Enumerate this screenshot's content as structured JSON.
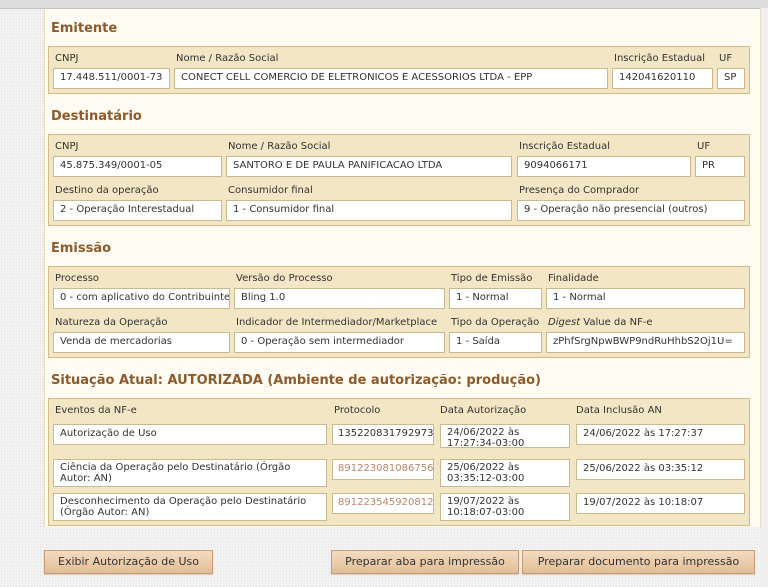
{
  "emitente": {
    "title": "Emitente",
    "labels": {
      "cnpj": "CNPJ",
      "razao": "Nome / Razão Social",
      "ie": "Inscrição Estadual",
      "uf": "UF"
    },
    "values": {
      "cnpj": "17.448.511/0001-73",
      "razao": "CONECT CELL COMERCIO DE ELETRONICOS E ACESSORIOS LTDA - EPP",
      "ie": "142041620110",
      "uf": "SP"
    }
  },
  "destinatario": {
    "title": "Destinatário",
    "labels": {
      "cnpj": "CNPJ",
      "razao": "Nome / Razão Social",
      "ie": "Inscrição Estadual",
      "uf": "UF",
      "destino": "Destino da operação",
      "consumidor": "Consumidor final",
      "presenca": "Presença do Comprador"
    },
    "values": {
      "cnpj": "45.875.349/0001-05",
      "razao": "SANTORO E DE PAULA PANIFICACAO LTDA",
      "ie": "9094066171",
      "uf": "PR",
      "destino": "2 - Operação Interestadual",
      "consumidor": "1 - Consumidor final",
      "presenca": "9 - Operação não presencial (outros)"
    }
  },
  "emissao": {
    "title": "Emissão",
    "labels": {
      "processo": "Processo",
      "versao": "Versão do Processo",
      "tipo_emissao": "Tipo de Emissão",
      "finalidade": "Finalidade",
      "natureza": "Natureza da Operação",
      "intermediador": "Indicador de Intermediador/Marketplace",
      "tipo_operacao": "Tipo da Operação",
      "digest_em": "Digest",
      "digest_rest": " Value da NF-e"
    },
    "values": {
      "processo": "0 - com aplicativo do Contribuinte",
      "versao": "Bling 1.0",
      "tipo_emissao": "1 - Normal",
      "finalidade": "1 - Normal",
      "natureza": "Venda de mercadorias",
      "intermediador": "0 - Operação sem intermediador",
      "tipo_operacao": "1 - Saída",
      "digest": "zPhfSrgNpwBWP9ndRuHhbS2Oj1U="
    }
  },
  "situacao": {
    "title": "Situação Atual: AUTORIZADA (Ambiente de autorização: produção)",
    "headers": {
      "eventos": "Eventos da NF-e",
      "protocolo": "Protocolo",
      "data_aut": "Data Autorização",
      "data_inc": "Data Inclusão AN"
    },
    "rows": [
      {
        "evento": "Autorização de Uso",
        "protocolo": "135220831792973",
        "data_aut": "24/06/2022 às 17:27:34-03:00",
        "data_inc": "24/06/2022 às 17:27:37"
      },
      {
        "evento": "Ciência da Operação pelo Destinatário (Órgão Autor: AN)",
        "protocolo": "891223081086756",
        "data_aut": "25/06/2022 às 03:35:12-03:00",
        "data_inc": "25/06/2022 às 03:35:12"
      },
      {
        "evento": "Desconhecimento da Operação pelo Destinatário (Órgão Autor: AN)",
        "protocolo": "891223545920812",
        "data_aut": "19/07/2022 às 10:18:07-03:00",
        "data_inc": "19/07/2022 às 10:18:07"
      }
    ]
  },
  "buttons": {
    "autorizacao": "Exibir Autorização de Uso",
    "aba": "Preparar aba para impressão",
    "documento": "Preparar documento para impressão"
  },
  "colors": {
    "section_title": "#8c5a2c",
    "box_bg": "#f2e6c5",
    "box_border": "#d1bc8c",
    "button_bg": "#e8c9a6",
    "link": "#b4886a"
  }
}
